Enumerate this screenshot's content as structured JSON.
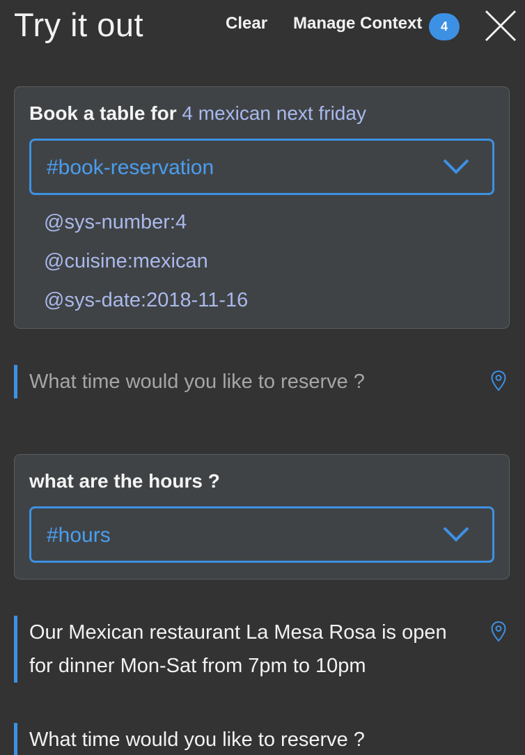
{
  "header": {
    "title": "Try it out",
    "clear_label": "Clear",
    "manage_context_label": "Manage Context",
    "context_count": "4"
  },
  "conversation": [
    {
      "user_text_plain": "Book a table for ",
      "user_text_entities": "4 mexican next friday",
      "intent": "#book-reservation",
      "entities": [
        "@sys-number:4",
        "@cuisine:mexican",
        "@sys-date:2018-11-16"
      ]
    },
    {
      "bot_response": "What time would you like to reserve ?"
    },
    {
      "user_text_plain": "what are the hours ?",
      "intent": "#hours"
    },
    {
      "bot_response": "Our Mexican restaurant La Mesa Rosa is open for dinner Mon-Sat from 7pm to 10pm"
    },
    {
      "bot_response": "What time would you like to reserve ?"
    }
  ],
  "colors": {
    "background": "#333333",
    "card": "#404345",
    "accent": "#3d91e4",
    "entity": "#aab9ec",
    "muted_text": "#a6a6a6"
  },
  "icons": {
    "close": "close-icon",
    "dropdown": "chevron-down-icon",
    "pin": "location-pin-icon"
  }
}
